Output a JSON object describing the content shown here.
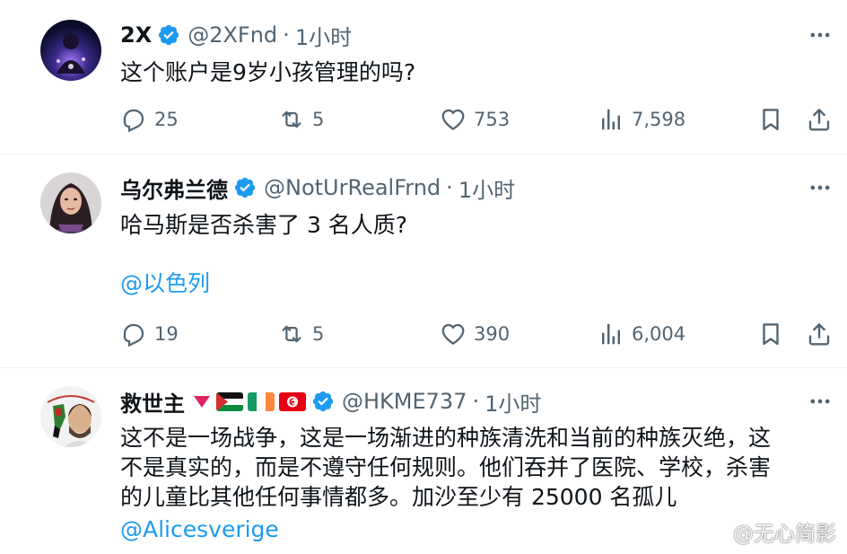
{
  "tweets": [
    {
      "name": "2X",
      "handle": "@2XFnd",
      "dot": "·",
      "time": "1小时",
      "text": "这个账户是9岁小孩管理的吗?",
      "replies": "25",
      "retweets": "5",
      "likes": "753",
      "views": "7,598"
    },
    {
      "name": "乌尔弗兰德",
      "handle": "@NotUrRealFrnd",
      "dot": "·",
      "time": "1小时",
      "text": "哈马斯是否杀害了 3 名人质?",
      "mention": "@以色列",
      "replies": "19",
      "retweets": "5",
      "likes": "390",
      "views": "6,004"
    },
    {
      "name": "救世主",
      "handle": "@HKME737",
      "dot": "·",
      "time": "1小时",
      "text_lines": [
        "这不是一场战争，这是一场渐进的种族清洗和当前的种族灭绝，这",
        "不是真实的，而是不遵守任何规则。他们吞并了医院、学校，杀害",
        "的儿童比其他任何事情都多。加沙至少有 25000 名孤儿"
      ],
      "mention": "@Alicesverige",
      "flags": [
        "palestine-flag",
        "ireland-flag",
        "tunisia-flag"
      ]
    }
  ],
  "watermark": "@无心简影",
  "colors": {
    "text": "#0f1419",
    "secondary": "#536471",
    "link": "#1d9bf0",
    "verified": "#1d9bf0",
    "divider": "#eff3f4"
  }
}
